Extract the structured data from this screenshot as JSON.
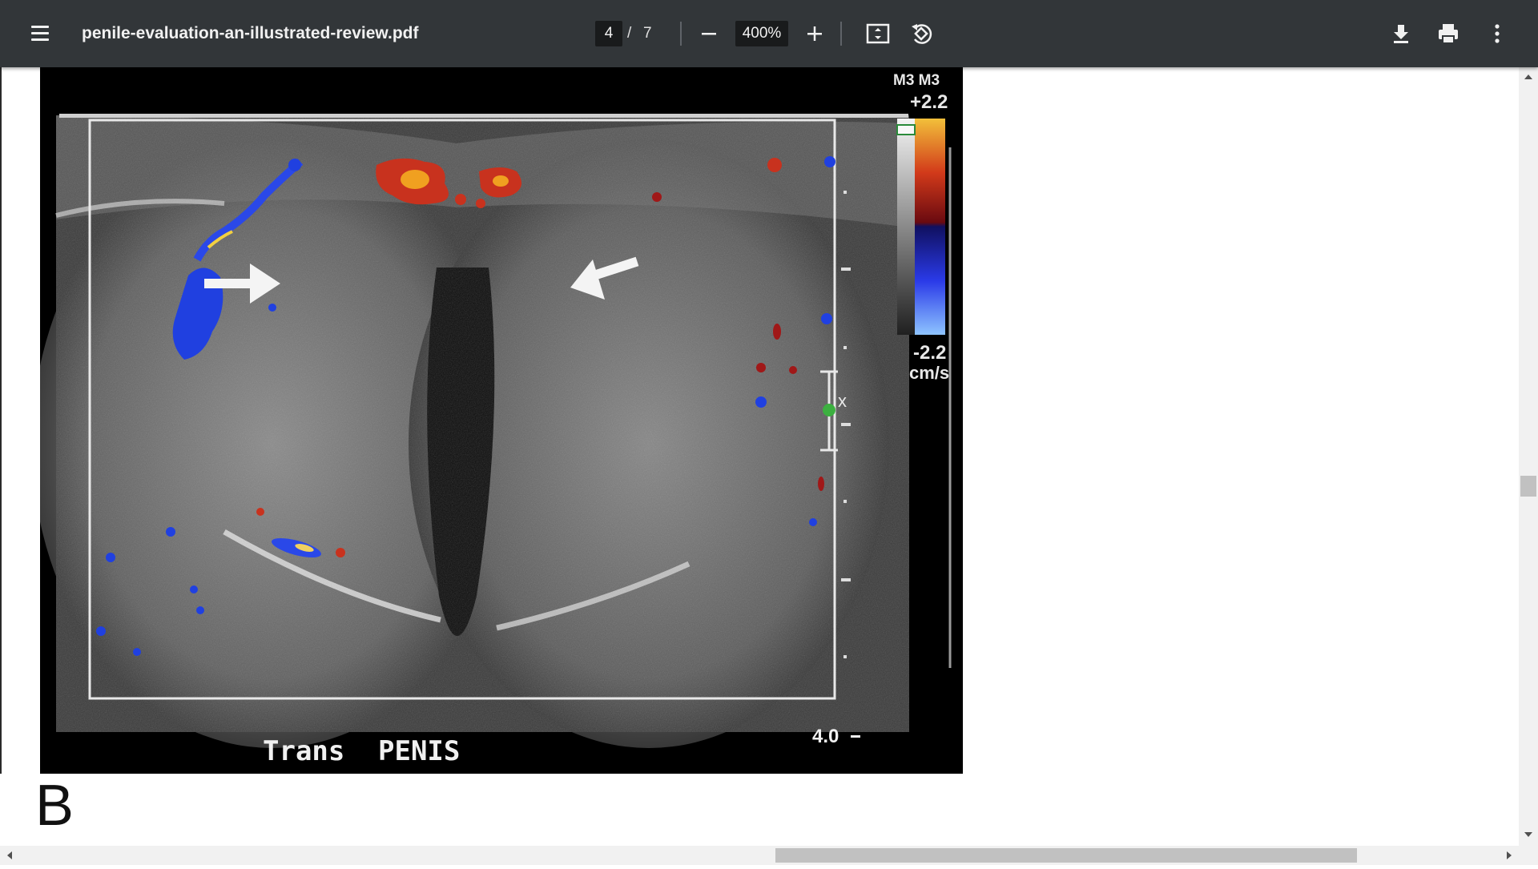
{
  "toolbar": {
    "title": "penile-evaluation-an-illustrated-review.pdf",
    "page_current": "4",
    "page_separator": "/",
    "page_total": "7",
    "zoom": "400%",
    "icons": [
      "menu-icon",
      "minus-icon",
      "plus-icon",
      "fit-page-icon",
      "rotate-icon",
      "download-icon",
      "print-icon",
      "more-vert-icon"
    ]
  },
  "ultrasound": {
    "caption_left": "Trans",
    "caption_right": "PENIS",
    "depth_label": "4.0",
    "scale_header": "M3 M3",
    "scale_top": "+2.2",
    "scale_bottom": "-2.2",
    "scale_unit": "cm/s",
    "marker": "x"
  },
  "figure": {
    "label": "B"
  },
  "colors": {
    "toolbar_bg": "#323639",
    "doppler_red": "#c8321e",
    "doppler_blue": "#2040e0"
  }
}
